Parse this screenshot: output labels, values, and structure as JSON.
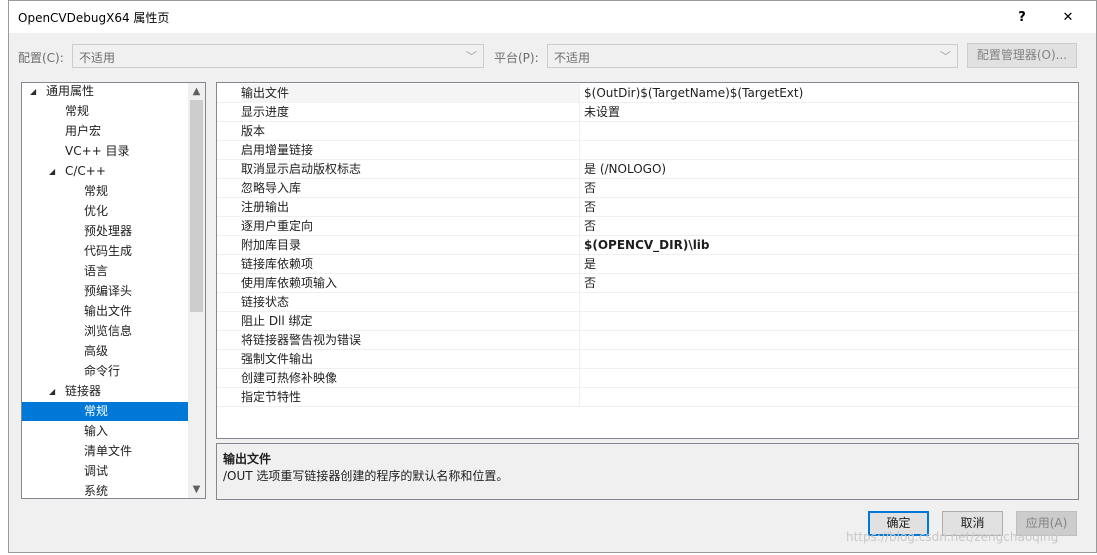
{
  "window": {
    "title": "OpenCVDebugX64 属性页",
    "help_label": "?",
    "close_label": "✕"
  },
  "config": {
    "config_label": "配置(C):",
    "config_value": "不适用",
    "platform_label": "平台(P):",
    "platform_value": "不适用",
    "manager_button": "配置管理器(O)..."
  },
  "tree": {
    "items": [
      {
        "label": "通用属性",
        "expander": "◢"
      },
      {
        "label": "常规"
      },
      {
        "label": "用户宏"
      },
      {
        "label": "VC++ 目录"
      },
      {
        "label": "C/C++",
        "expander": "◢"
      },
      {
        "label": "常规"
      },
      {
        "label": "优化"
      },
      {
        "label": "预处理器"
      },
      {
        "label": "代码生成"
      },
      {
        "label": "语言"
      },
      {
        "label": "预编译头"
      },
      {
        "label": "输出文件"
      },
      {
        "label": "浏览信息"
      },
      {
        "label": "高级"
      },
      {
        "label": "命令行"
      },
      {
        "label": "链接器",
        "expander": "◢"
      },
      {
        "label": "常规",
        "selected": true
      },
      {
        "label": "输入"
      },
      {
        "label": "清单文件"
      },
      {
        "label": "调试"
      },
      {
        "label": "系统"
      }
    ]
  },
  "grid": {
    "rows": [
      {
        "name": "输出文件",
        "value": "$(OutDir)$(TargetName)$(TargetExt)"
      },
      {
        "name": "显示进度",
        "value": "未设置"
      },
      {
        "name": "版本",
        "value": ""
      },
      {
        "name": "启用增量链接",
        "value": ""
      },
      {
        "name": "取消显示启动版权标志",
        "value": "是 (/NOLOGO)"
      },
      {
        "name": "忽略导入库",
        "value": "否"
      },
      {
        "name": "注册输出",
        "value": "否"
      },
      {
        "name": "逐用户重定向",
        "value": "否"
      },
      {
        "name": "附加库目录",
        "value": "$(OPENCV_DIR)\\lib",
        "bold": true
      },
      {
        "name": "链接库依赖项",
        "value": "是"
      },
      {
        "name": "使用库依赖项输入",
        "value": "否"
      },
      {
        "name": "链接状态",
        "value": ""
      },
      {
        "name": "阻止 Dll 绑定",
        "value": ""
      },
      {
        "name": "将链接器警告视为错误",
        "value": ""
      },
      {
        "name": "强制文件输出",
        "value": ""
      },
      {
        "name": "创建可热修补映像",
        "value": ""
      },
      {
        "name": "指定节特性",
        "value": ""
      }
    ]
  },
  "description": {
    "title": "输出文件",
    "text": "/OUT 选项重写链接器创建的程序的默认名称和位置。"
  },
  "buttons": {
    "ok": "确定",
    "cancel": "取消",
    "apply": "应用(A)"
  },
  "watermark": "https://blog.csdn.net/zengchaoqing",
  "colors": {
    "selection": "#0078d7",
    "dialog_bg": "#f0f0f0"
  }
}
